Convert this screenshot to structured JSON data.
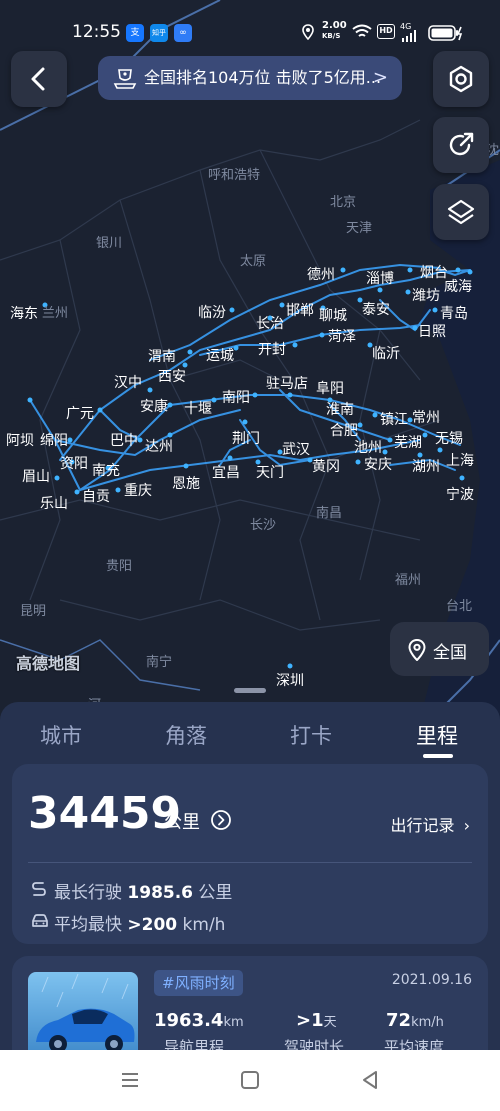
{
  "status_bar": {
    "time": "12:55",
    "app_icons": [
      "支",
      "知乎",
      "∞"
    ],
    "app_icon_colors": [
      "#1677ff",
      "#0f88eb",
      "#2f7cf6"
    ],
    "net_speed_top": "2.00",
    "net_speed_bottom": "KB/S",
    "hd_label": "HD",
    "signal_label": "4G"
  },
  "header": {
    "back_icon": "back-arrow-icon",
    "rank_text": "全国排名104万位 击败了5亿用...",
    "rank_chevron": ">",
    "settings_icon": "gear-icon",
    "share_icon": "share-icon",
    "layers_icon": "layers-icon"
  },
  "map": {
    "watermark": "高德地图",
    "national_button_label": "全国",
    "accent_route_color": "#3a9ef5",
    "cities_visited": [
      "海东",
      "阿坝",
      "绵阳",
      "广元",
      "资阳",
      "眉山",
      "乐山",
      "自贡",
      "南充",
      "重庆",
      "巴中",
      "达州",
      "汉中",
      "安康",
      "十堰",
      "西安",
      "渭南",
      "运城",
      "临汾",
      "长治",
      "邯郸",
      "开封",
      "德州",
      "聊城",
      "菏泽",
      "泰安",
      "淄博",
      "潍坊",
      "烟台",
      "威海",
      "青岛",
      "日照",
      "临沂",
      "驻马店",
      "阜阳",
      "南阳",
      "淮南",
      "合肥",
      "镇江",
      "常州",
      "无锡",
      "芜湖",
      "池州",
      "安庆",
      "湖州",
      "上海",
      "宁波",
      "荆门",
      "武汉",
      "黄冈",
      "宜昌",
      "天门",
      "恩施",
      "深圳"
    ],
    "cities_dim": [
      "兰州",
      "银川",
      "呼和浩特",
      "北京",
      "天津",
      "太原",
      "长沙",
      "南昌",
      "贵阳",
      "福州",
      "台北",
      "昆明",
      "南宁",
      "沈",
      "河"
    ]
  },
  "panel": {
    "tabs": [
      "城市",
      "角落",
      "打卡",
      "里程"
    ],
    "active_tab": "里程",
    "total_km": "34459",
    "total_km_unit": "公里",
    "trips_link": "出行记录",
    "longest_label": "最长行驶",
    "longest_value": "1985.6",
    "longest_unit": "公里",
    "fastest_label": "平均最快",
    "fastest_value": ">200",
    "fastest_unit": "km/h"
  },
  "trip": {
    "tag": "#风雨时刻",
    "date": "2021.09.16",
    "distance_value": "1963.4",
    "distance_unit": "km",
    "distance_label": "导航里程",
    "duration_value": ">1",
    "duration_unit": "天",
    "duration_label": "驾驶时长",
    "speed_value": "72",
    "speed_unit": "km/h",
    "speed_label": "平均速度"
  },
  "nav_bar": {
    "menu_icon": "menu-icon",
    "home_icon": "home-square-icon",
    "back_icon": "back-triangle-icon"
  }
}
